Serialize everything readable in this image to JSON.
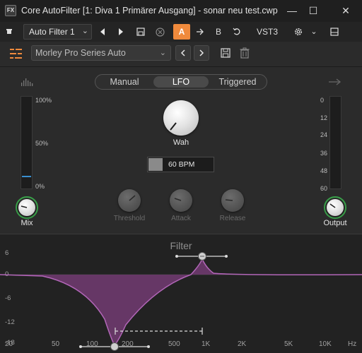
{
  "window": {
    "icon_text": "FX",
    "title": "Core AutoFilter [1: Diva 1 Primärer Ausgang] - sonar neu test.cwp",
    "minimize": "—",
    "maximize": "☐",
    "close": "✕"
  },
  "host_toolbar": {
    "preset_name": "Auto Filter 1",
    "ab_a": "A",
    "ab_b": "B",
    "plugin_format": "VST3"
  },
  "plugin_header": {
    "preset": "Morley Pro Series Auto"
  },
  "modes": [
    {
      "label": "Manual",
      "active": false
    },
    {
      "label": "LFO",
      "active": true
    },
    {
      "label": "Triggered",
      "active": false
    }
  ],
  "mix": {
    "label": "Mix",
    "scale": [
      "100%",
      "50%",
      "0%"
    ],
    "level": 0.12
  },
  "wah": {
    "label": "Wah",
    "bpm": "60 BPM"
  },
  "envelope_knobs": [
    {
      "label": "Threshold"
    },
    {
      "label": "Attack"
    },
    {
      "label": "Release"
    }
  ],
  "output": {
    "label": "Output",
    "scale": [
      "0",
      "12",
      "24",
      "36",
      "48",
      "60"
    ]
  },
  "filter": {
    "title": "Filter",
    "y_labels": [
      "6",
      "0",
      "-6",
      "-12",
      "-18"
    ],
    "x_labels": [
      "20",
      "50",
      "100",
      "200",
      "500",
      "1K",
      "2K",
      "5K",
      "10K",
      "Hz"
    ],
    "curve_color": "#b266b8",
    "fill_color": "#6e3a6e"
  }
}
